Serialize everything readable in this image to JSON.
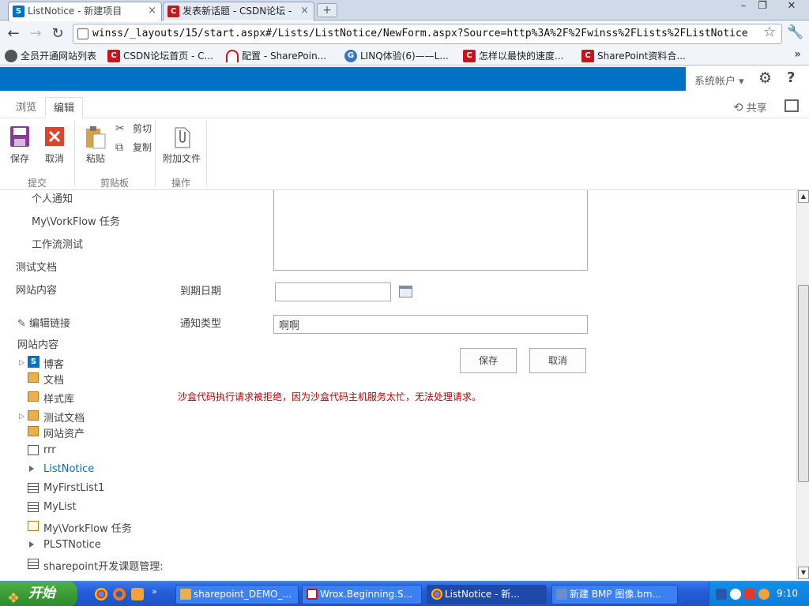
{
  "browser": {
    "tabs": [
      {
        "title": "ListNotice - 新建项目",
        "close": "×"
      },
      {
        "title": "发表新话题 - CSDN论坛 - ",
        "close": "×"
      }
    ],
    "new_tab": "+",
    "url": "winss/_layouts/15/start.aspx#/Lists/ListNotice/NewForm.aspx?Source=http%3A%2F%2Fwinss%2FLists%2FListNotice",
    "bookmarks": [
      "全员开通网站列表",
      "CSDN论坛首页 - C...",
      "配置 - SharePoin...",
      "LINQ体验(6)——L...",
      "怎样以最快的速度...",
      "SharePoint资料合..."
    ],
    "bookmarks_more": "»",
    "window_controls": {
      "minimize": "–",
      "restore": "❐",
      "close": "✕"
    }
  },
  "suite": {
    "user_menu": "系统帐户 ▾",
    "settings_icon": "gear-icon",
    "help": "?"
  },
  "ribbon": {
    "tabs": [
      "浏览",
      "编辑"
    ],
    "selected_tab": "编辑",
    "share": "共享",
    "buttons": {
      "save": "保存",
      "cancel": "取消",
      "paste": "粘贴",
      "cut": "剪切",
      "copy": "复制",
      "attach": "附加文件"
    },
    "groups": {
      "commit": "提交",
      "clipboard": "剪贴板",
      "actions": "操作"
    }
  },
  "quicklaunch": {
    "top_items": [
      "个人通知",
      "My\\VorkFlow 任务",
      "工作流测试"
    ],
    "test_docs": "测试文档",
    "site_contents_1": "网站内容",
    "edit_links": "编辑链接",
    "site_contents_2": "网站内容",
    "tree": [
      {
        "label": "博客",
        "icon": "sharepoint-site-icon",
        "expandable": true
      },
      {
        "label": "文档",
        "icon": "library-icon",
        "expandable": false
      },
      {
        "label": "样式库",
        "icon": "library-icon",
        "expandable": false
      },
      {
        "label": "测试文档",
        "icon": "library-icon",
        "expandable": true
      },
      {
        "label": "网站资产",
        "icon": "library-icon",
        "expandable": false
      },
      {
        "label": "rrr",
        "icon": "picture-library-icon",
        "expandable": false
      },
      {
        "label": "ListNotice",
        "icon": "announcement-icon",
        "expandable": false,
        "current": true
      },
      {
        "label": "MyFirstList1",
        "icon": "list-icon",
        "expandable": false
      },
      {
        "label": "MyList",
        "icon": "list-icon",
        "expandable": false
      },
      {
        "label": "My\\VorkFlow 任务",
        "icon": "task-icon",
        "expandable": false
      },
      {
        "label": "PLSTNotice",
        "icon": "announcement-icon",
        "expandable": false
      },
      {
        "label": "sharepoint开发课题管理:",
        "icon": "list-icon",
        "expandable": false
      }
    ]
  },
  "form": {
    "due_date_label": "到期日期",
    "due_date_value": "",
    "notice_type_label": "通知类型",
    "notice_type_value": "啊啊",
    "save_button": "保存",
    "cancel_button": "取消",
    "error": "沙盒代码执行请求被拒绝，因为沙盒代码主机服务太忙，无法处理请求。"
  },
  "taskbar": {
    "start": "开始",
    "tasks": [
      "sharepoint_DEMO_...",
      "Wrox.Beginning.S...",
      "ListNotice - 新...",
      "新建 BMP 图像.bm..."
    ],
    "clock": "9:10"
  },
  "colors": {
    "suite_bar": "#0072c6",
    "link_current": "#0072c6",
    "error": "#bf0000"
  }
}
